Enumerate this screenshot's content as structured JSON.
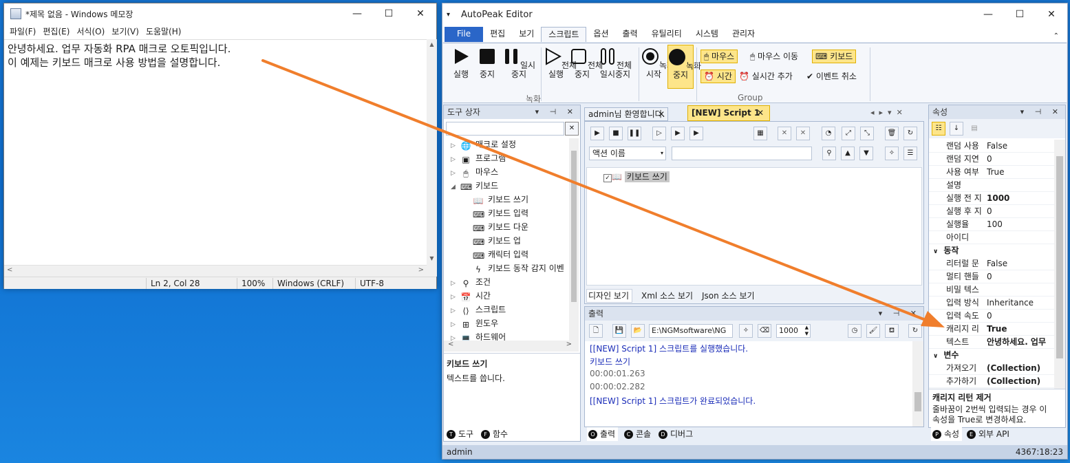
{
  "notepad": {
    "title": "*제목 없음 - Windows 메모장",
    "menu": [
      "파일(F)",
      "편집(E)",
      "서식(O)",
      "보기(V)",
      "도움말(H)"
    ],
    "content": "안녕하세요. 업무 자동화 RPA 매크로 오토픽입니다.\n이 예제는 키보드 매크로 사용 방법을 설명합니다.",
    "status": {
      "position": "Ln 2, Col 28",
      "zoom": "100%",
      "line_ending": "Windows (CRLF)",
      "encoding": "UTF-8"
    }
  },
  "app": {
    "title": "AutoPeak Editor",
    "tabs": [
      "File",
      "편집",
      "보기",
      "스크립트",
      "옵션",
      "출력",
      "유틸리티",
      "시스템",
      "관리자"
    ],
    "active_tab": "스크립트",
    "ribbon": {
      "run": "실행",
      "stop": "중지",
      "pause": "일시중지",
      "run_all": "전체\n실행",
      "stop_all": "전체\n중지",
      "pause_all": "전체\n일시중지",
      "rec_start": "녹화\n시작",
      "rec_stop": "녹화\n중지",
      "group_rec": "녹화",
      "mouse": "마우스",
      "mouse_move": "마우스 이동",
      "keyboard": "키보드",
      "time": "시간",
      "realtime_add": "실시간 추가",
      "event_cancel": "이벤트 취소",
      "group": "Group"
    },
    "toolbox": {
      "title": "도구 상자",
      "items": [
        "매크로 설정",
        "프로그램",
        "마우스",
        "키보드",
        "키보드 쓰기",
        "키보드 입력",
        "키보드 다운",
        "키보드 업",
        "캐릭터 입력",
        "키보드 동작 감지 이벤",
        "조건",
        "시간",
        "스크립트",
        "윈도우",
        "하드웨어"
      ],
      "desc_title": "키보드 쓰기",
      "desc": "텍스트를 씁니다.",
      "tabs": [
        "도구",
        "함수"
      ],
      "tab_letters": [
        "T",
        "F"
      ]
    },
    "editor": {
      "tabs": [
        "admin님 환영합니다.",
        "[NEW] Script 1"
      ],
      "action_combo": "액션 이름",
      "node": "키보드 쓰기",
      "view_tabs": [
        "디자인 보기",
        "Xml 소스 보기",
        "Json 소스 보기"
      ]
    },
    "output": {
      "title": "출력",
      "path": "E:\\NGMsoftware\\NG",
      "num": "1000",
      "lines": [
        "[[NEW] Script 1] 스크립트를 실행했습니다.",
        "키보드 쓰기",
        "00:00:01.263",
        "00:00:02.282",
        "[[NEW] Script 1] 스크립트가 완료되었습니다."
      ],
      "tabs": [
        "출력",
        "콘솔",
        "디버그"
      ],
      "tab_letters": [
        "O",
        "C",
        "D"
      ]
    },
    "properties": {
      "title": "속성",
      "rows": [
        [
          "랜덤 사용",
          "False"
        ],
        [
          "랜덤 지연",
          "0"
        ],
        [
          "사용 여부",
          "True"
        ],
        [
          "설명",
          ""
        ],
        [
          "실행 전 지",
          "1000"
        ],
        [
          "실행 후 지",
          "0"
        ],
        [
          "실행율",
          "100"
        ],
        [
          "아이디",
          ""
        ]
      ],
      "cat_action": "동작",
      "rows2": [
        [
          "리터럴 문",
          "False"
        ],
        [
          "멀티 핸들",
          "0"
        ],
        [
          "비밀 텍스",
          ""
        ],
        [
          "입력 방식",
          "Inheritance"
        ],
        [
          "입력 속도",
          "0"
        ],
        [
          "캐리지 리",
          "True"
        ],
        [
          "텍스트",
          "안녕하세요. 업무"
        ]
      ],
      "cat_var": "변수",
      "rows3": [
        [
          "가져오기",
          "(Collection)"
        ],
        [
          "추가하기",
          "(Collection)"
        ]
      ],
      "desc_title": "캐리지 리턴 제거",
      "desc": "줄바꿈이 2번씩 입력되는 경우 이\n속성을 True로 변경하세요.",
      "tabs": [
        "속성",
        "외부 API"
      ],
      "tab_letters": [
        "P",
        "E"
      ]
    },
    "status": {
      "user": "admin",
      "time": "4367:18:23"
    }
  },
  "colors": {
    "arrow": "#f07e2c",
    "accent": "#2a66c8",
    "highlight": "#fde58a"
  }
}
